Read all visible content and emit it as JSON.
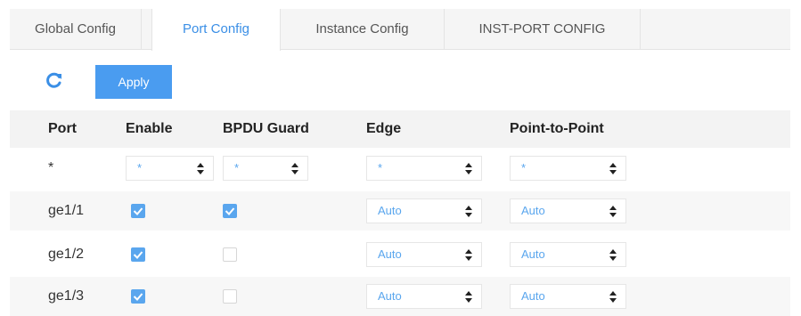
{
  "tabs": [
    {
      "label": "Global Config"
    },
    {
      "label": "Port Config"
    },
    {
      "label": "Instance Config"
    },
    {
      "label": "INST-PORT CONFIG"
    }
  ],
  "active_tab": "Port Config",
  "toolbar": {
    "refresh_icon": "refresh-icon",
    "apply_label": "Apply"
  },
  "table": {
    "columns": [
      "Port",
      "Enable",
      "BPDU Guard",
      "Edge",
      "Point-to-Point"
    ],
    "filter_row": {
      "port": "*",
      "enable": "*",
      "bpdu_guard": "*",
      "edge": "*",
      "point_to_point": "*"
    },
    "rows": [
      {
        "port": "ge1/1",
        "enable": true,
        "bpdu_guard": true,
        "edge": "Auto",
        "point_to_point": "Auto"
      },
      {
        "port": "ge1/2",
        "enable": true,
        "bpdu_guard": false,
        "edge": "Auto",
        "point_to_point": "Auto"
      },
      {
        "port": "ge1/3",
        "enable": true,
        "bpdu_guard": false,
        "edge": "Auto",
        "point_to_point": "Auto"
      }
    ]
  },
  "colors": {
    "accent": "#4a9cf0",
    "checkbox_on": "#5aa6ee"
  }
}
